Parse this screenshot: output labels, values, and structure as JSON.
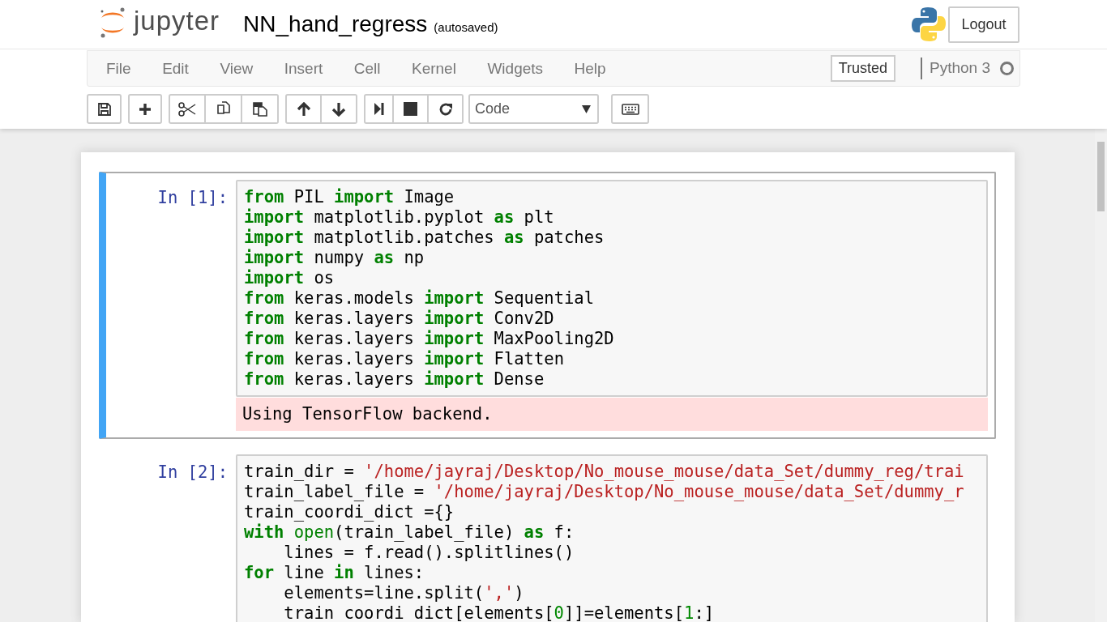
{
  "header": {
    "logo_text": "jupyter",
    "notebook_name": "NN_hand_regress",
    "autosave": "(autosaved)",
    "logout": "Logout"
  },
  "menu": {
    "items": [
      "File",
      "Edit",
      "View",
      "Insert",
      "Cell",
      "Kernel",
      "Widgets",
      "Help"
    ],
    "trusted": "Trusted",
    "kernel_name": "Python 3",
    "kernel_busy": false
  },
  "toolbar": {
    "cell_type": "Code"
  },
  "cells": [
    {
      "prompt": "In [1]:",
      "selected": true,
      "lines": [
        [
          {
            "kind": "kw",
            "text": "from"
          },
          {
            "kind": "plain",
            "text": " PIL "
          },
          {
            "kind": "kw",
            "text": "import"
          },
          {
            "kind": "plain",
            "text": " Image"
          }
        ],
        [
          {
            "kind": "kw",
            "text": "import"
          },
          {
            "kind": "plain",
            "text": " matplotlib.pyplot "
          },
          {
            "kind": "kw",
            "text": "as"
          },
          {
            "kind": "plain",
            "text": " plt"
          }
        ],
        [
          {
            "kind": "kw",
            "text": "import"
          },
          {
            "kind": "plain",
            "text": " matplotlib.patches "
          },
          {
            "kind": "kw",
            "text": "as"
          },
          {
            "kind": "plain",
            "text": " patches"
          }
        ],
        [
          {
            "kind": "kw",
            "text": "import"
          },
          {
            "kind": "plain",
            "text": " numpy "
          },
          {
            "kind": "kw",
            "text": "as"
          },
          {
            "kind": "plain",
            "text": " np"
          }
        ],
        [
          {
            "kind": "kw",
            "text": "import"
          },
          {
            "kind": "plain",
            "text": " os"
          }
        ],
        [
          {
            "kind": "kw",
            "text": "from"
          },
          {
            "kind": "plain",
            "text": " keras.models "
          },
          {
            "kind": "kw",
            "text": "import"
          },
          {
            "kind": "plain",
            "text": " Sequential"
          }
        ],
        [
          {
            "kind": "kw",
            "text": "from"
          },
          {
            "kind": "plain",
            "text": " keras.layers "
          },
          {
            "kind": "kw",
            "text": "import"
          },
          {
            "kind": "plain",
            "text": " Conv2D"
          }
        ],
        [
          {
            "kind": "kw",
            "text": "from"
          },
          {
            "kind": "plain",
            "text": " keras.layers "
          },
          {
            "kind": "kw",
            "text": "import"
          },
          {
            "kind": "plain",
            "text": " MaxPooling2D"
          }
        ],
        [
          {
            "kind": "kw",
            "text": "from"
          },
          {
            "kind": "plain",
            "text": " keras.layers "
          },
          {
            "kind": "kw",
            "text": "import"
          },
          {
            "kind": "plain",
            "text": " Flatten"
          }
        ],
        [
          {
            "kind": "kw",
            "text": "from"
          },
          {
            "kind": "plain",
            "text": " keras.layers "
          },
          {
            "kind": "kw",
            "text": "import"
          },
          {
            "kind": "plain",
            "text": " Dense"
          }
        ]
      ],
      "output": {
        "kind": "stderr",
        "text": "Using TensorFlow backend."
      }
    },
    {
      "prompt": "In [2]:",
      "selected": false,
      "lines": [
        [
          {
            "kind": "plain",
            "text": "train_dir = "
          },
          {
            "kind": "str",
            "text": "'/home/jayraj/Desktop/No_mouse_mouse/data_Set/dummy_reg/trai"
          }
        ],
        [
          {
            "kind": "plain",
            "text": "train_label_file = "
          },
          {
            "kind": "str",
            "text": "'/home/jayraj/Desktop/No_mouse_mouse/data_Set/dummy_r"
          }
        ],
        [
          {
            "kind": "plain",
            "text": "train_coordi_dict ={}"
          }
        ],
        [
          {
            "kind": "kw",
            "text": "with"
          },
          {
            "kind": "builtin",
            "text": " open"
          },
          {
            "kind": "plain",
            "text": "(train_label_file) "
          },
          {
            "kind": "kw",
            "text": "as"
          },
          {
            "kind": "plain",
            "text": " f:"
          }
        ],
        [
          {
            "kind": "plain",
            "text": "    lines = f.read().splitlines()"
          }
        ],
        [
          {
            "kind": "kw",
            "text": "for"
          },
          {
            "kind": "plain",
            "text": " line "
          },
          {
            "kind": "kw",
            "text": "in"
          },
          {
            "kind": "plain",
            "text": " lines:"
          }
        ],
        [
          {
            "kind": "plain",
            "text": "    elements=line.split("
          },
          {
            "kind": "str",
            "text": "','"
          },
          {
            "kind": "plain",
            "text": ")"
          }
        ],
        [
          {
            "kind": "plain",
            "text": "    train_coordi_dict[elements["
          },
          {
            "kind": "num",
            "text": "0"
          },
          {
            "kind": "plain",
            "text": "]]=elements["
          },
          {
            "kind": "num",
            "text": "1"
          },
          {
            "kind": "plain",
            "text": ":]"
          }
        ]
      ]
    }
  ]
}
